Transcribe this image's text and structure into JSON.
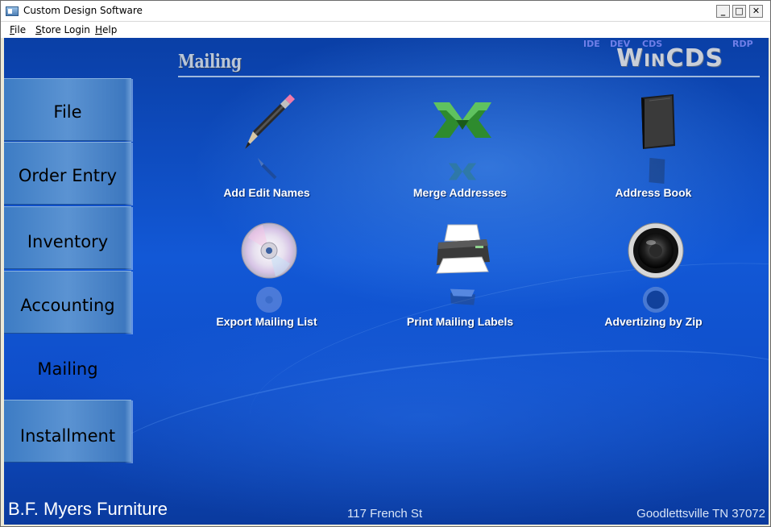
{
  "window": {
    "title": "Custom Design Software",
    "buttons": {
      "minimize": "_",
      "maximize": "□",
      "close": "✕"
    }
  },
  "menu": {
    "items": [
      {
        "label": "File"
      },
      {
        "label": "Store Login"
      },
      {
        "label": "Help"
      }
    ]
  },
  "header": {
    "section_title": "Mailing",
    "tags": {
      "ide": "IDE",
      "dev": "DEV",
      "cds": "CDS",
      "rdp": "RDP"
    },
    "logo": "WinCDS"
  },
  "nav": {
    "items": [
      {
        "label": "File",
        "active": false
      },
      {
        "label": "Order Entry",
        "active": false
      },
      {
        "label": "Inventory",
        "active": false
      },
      {
        "label": "Accounting",
        "active": false
      },
      {
        "label": "Mailing",
        "active": true
      },
      {
        "label": "Installment",
        "active": false
      }
    ]
  },
  "tiles": [
    {
      "label": "Add Edit Names",
      "icon": "pencil-icon"
    },
    {
      "label": "Merge Addresses",
      "icon": "merge-arrows-icon"
    },
    {
      "label": "Address Book",
      "icon": "book-icon"
    },
    {
      "label": "Export Mailing List",
      "icon": "cd-icon"
    },
    {
      "label": "Print Mailing Labels",
      "icon": "printer-icon"
    },
    {
      "label": "Advertizing by Zip",
      "icon": "speaker-icon"
    }
  ],
  "footer": {
    "company": "B.F. Myers Furniture",
    "address": "117 French St",
    "city": "Goodlettsville TN 37072"
  },
  "colors": {
    "background": "#1258d6",
    "tab": "#5b93d2",
    "label": "#ffffff",
    "logo": "#c9ced8",
    "tags": "#6f7fe8"
  }
}
